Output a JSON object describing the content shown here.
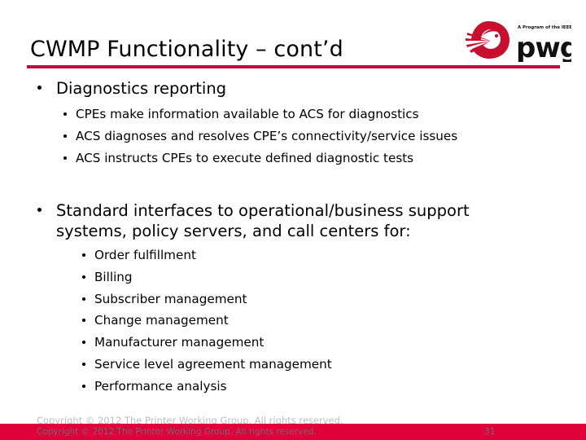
{
  "slide": {
    "title": "CWMP Functionality – cont’d",
    "accent_rule_color": "#bf0d3e",
    "footer_bar_color": "#e0003c"
  },
  "logo": {
    "tagline": "A Program of the IEEE-ISTO",
    "wordmark": "pwg",
    "mark_color": "#c8102e"
  },
  "content": {
    "bullet1": {
      "text": "Diagnostics reporting",
      "sub": [
        "CPEs make information available to ACS for diagnostics",
        "ACS diagnoses and resolves CPE’s connectivity/service issues",
        "ACS instructs CPEs to execute defined diagnostic tests"
      ]
    },
    "bullet2": {
      "text": "Standard interfaces to operational/business support systems, policy servers, and call centers for:",
      "sub": [
        "Order fulfillment",
        "Billing",
        "Subscriber management",
        "Change management",
        "Manufacturer management",
        "Service level agreement management",
        "Performance analysis"
      ]
    }
  },
  "footer": {
    "copyright": "Copyright © 2012 The Printer Working Group. All rights reserved.",
    "copyright_ghost": "Copyright © 2012 The Printer Working Group. All rights reserved.",
    "page_number": "31"
  }
}
